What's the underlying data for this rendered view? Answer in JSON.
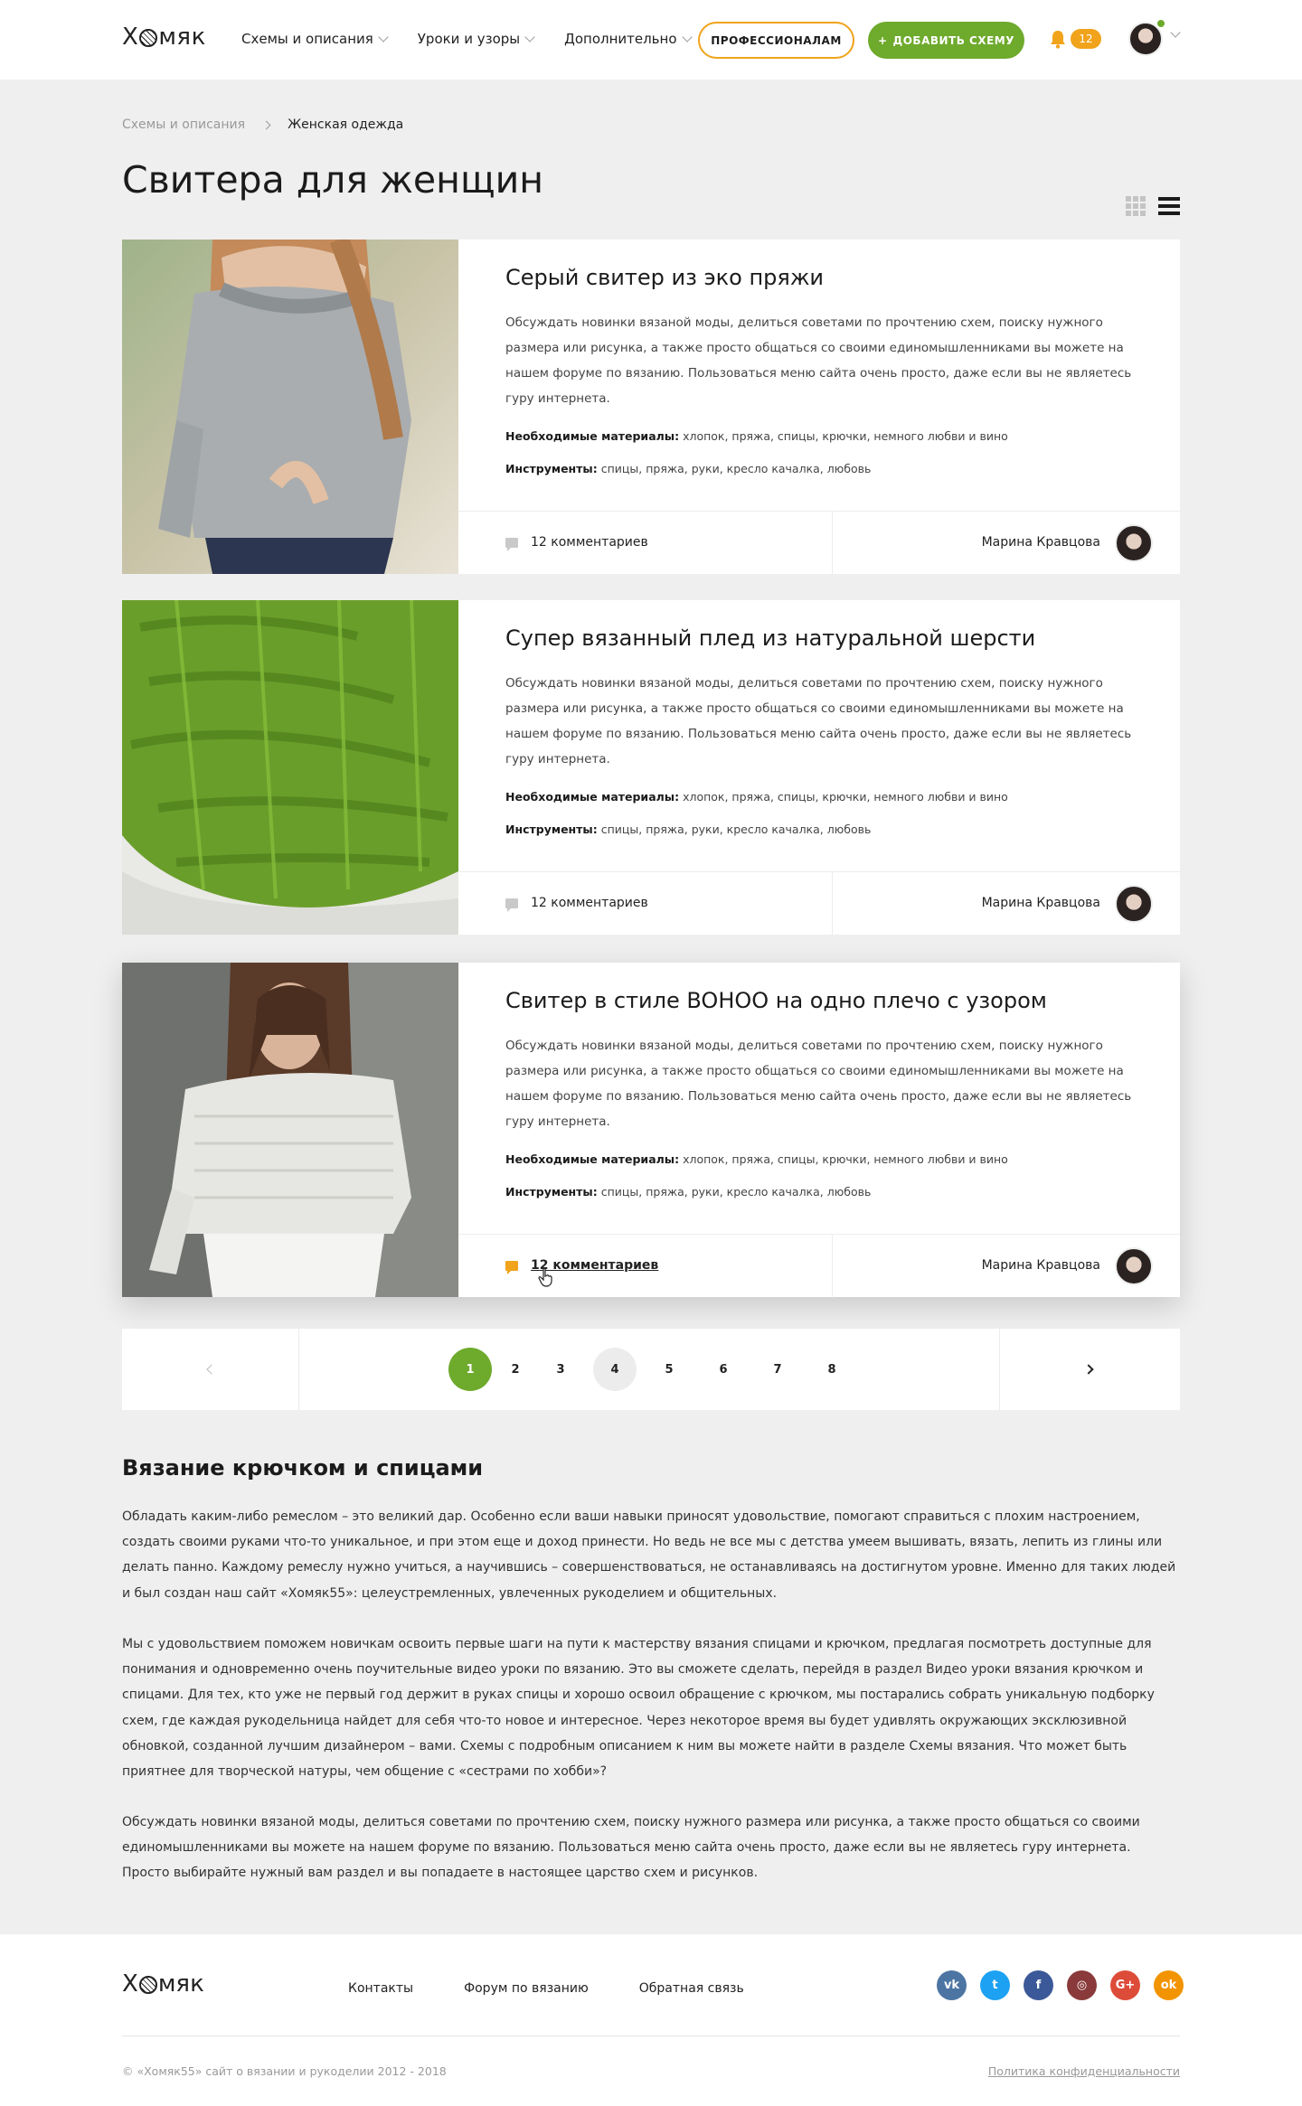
{
  "header": {
    "logo": "Хомяк",
    "nav": [
      {
        "label": "Схемы и описания"
      },
      {
        "label": "Уроки и узоры"
      },
      {
        "label": "Дополнительно"
      }
    ],
    "btn_pro": "ПРОФЕССИОНАЛАМ",
    "btn_add": "ДОБАВИТЬ СХЕМУ",
    "notifications": "12",
    "accent": "#6eaa2c",
    "orange": "#f0a31b"
  },
  "breadcrumb": {
    "parent": "Схемы и описания",
    "current": "Женская одежда"
  },
  "page_title": "Свитера для женщин",
  "cards": [
    {
      "title": "Серый свитер из эко пряжи",
      "desc": "Обсуждать новинки вязаной моды, делиться советами по прочтению схем, поиску нужного размера или рисунка, а также просто общаться со своими единомышленниками вы можете на нашем форуме по вязанию. Пользоваться меню сайта очень просто, даже если вы не являетесь гуру интернета.",
      "materials_label": "Необходимые материалы:",
      "materials": "хлопок, пряжа, спицы, крючки, немного любви и вино",
      "tools_label": "Инструменты:",
      "tools": "спицы, пряжа, руки, кресло качалка, любовь",
      "comments": "12 комментариев",
      "author": "Марина Кравцова"
    },
    {
      "title": "Супер вязанный плед из натуральной шерсти",
      "desc": "Обсуждать новинки вязаной моды, делиться советами по прочтению схем, поиску нужного размера или рисунка, а также просто общаться со своими единомышленниками вы можете на нашем форуме по вязанию. Пользоваться меню сайта очень просто, даже если вы не являетесь гуру интернета.",
      "materials_label": "Необходимые материалы:",
      "materials": "хлопок, пряжа, спицы, крючки, немного любви и вино",
      "tools_label": "Инструменты:",
      "tools": "спицы, пряжа, руки, кресло качалка, любовь",
      "comments": "12 комментариев",
      "author": "Марина Кравцова"
    },
    {
      "title": "Свитер в стиле BOHOO на одно плечо с узором",
      "desc": "Обсуждать новинки вязаной моды, делиться советами по прочтению схем, поиску нужного размера или рисунка, а также просто общаться со своими единомышленниками вы можете на нашем форуме по вязанию. Пользоваться меню сайта очень просто, даже если вы не являетесь гуру интернета.",
      "materials_label": "Необходимые материалы:",
      "materials": "хлопок, пряжа, спицы, крючки, немного любви и вино",
      "tools_label": "Инструменты:",
      "tools": "спицы, пряжа, руки, кресло качалка, любовь",
      "comments": "12 комментариев",
      "author": "Марина Кравцова"
    }
  ],
  "pagination": {
    "pages": [
      "1",
      "2",
      "3",
      "4",
      "5",
      "6",
      "7",
      "8"
    ],
    "current": "1"
  },
  "article": {
    "title": "Вязание крючком и спицами",
    "p1": "Обладать каким-либо ремеслом – это великий дар. Особенно если ваши навыки приносят удовольствие, помогают справиться с плохим настроением, создать своими руками что-то уникальное, и при этом еще и доход принести. Но ведь не все мы с детства умеем вышивать, вязать, лепить из глины или делать панно. Каждому ремеслу нужно учиться, а научившись – совершенствоваться, не останавливаясь на достигнутом уровне. Именно для таких людей и был создан наш сайт «Хомяк55»: целеустремленных, увлеченных рукоделием и общительных.",
    "p2": "Мы с удовольствием поможем новичкам освоить первые шаги на пути к мастерству вязания спицами и крючком, предлагая посмотреть доступные для понимания и одновременно очень поучительные видео уроки по вязанию. Это вы сможете сделать, перейдя в раздел Видео уроки вязания крючком и спицами. Для тех, кто уже не первый год держит в руках спицы и хорошо освоил обращение с крючком, мы постарались собрать уникальную подборку схем, где каждая рукодельница найдет для себя что-то новое и интересное. Через некоторое время вы будет удивлять окружающих эксклюзивной обновкой, созданной лучшим дизайнером – вами. Схемы с подробным описанием к ним вы можете найти в разделе Схемы вязания. Что может быть приятнее для творческой натуры, чем общение с «сестрами по хобби»?",
    "p3": "Обсуждать новинки вязаной моды, делиться советами по прочтению схем, поиску нужного размера или рисунка, а также просто общаться со своими единомышленниками вы можете на нашем форуме по вязанию. Пользоваться меню сайта очень просто, даже если вы не являетесь гуру интернета. Просто выбирайте нужный вам раздел и вы попадаете в настоящее царство схем и рисунков."
  },
  "footer": {
    "logo": "Хомяк",
    "links": [
      "Контакты",
      "Форум по вязанию",
      "Обратная связь"
    ],
    "socials": [
      {
        "icon": "vk-icon",
        "glyph": "vk",
        "color": "#4c75a3"
      },
      {
        "icon": "twitter-icon",
        "glyph": "t",
        "color": "#1da1f2"
      },
      {
        "icon": "facebook-icon",
        "glyph": "f",
        "color": "#3b5998"
      },
      {
        "icon": "instagram-icon",
        "glyph": "◎",
        "color": "#8a3a3a"
      },
      {
        "icon": "googleplus-icon",
        "glyph": "G+",
        "color": "#dd4b39"
      },
      {
        "icon": "odnoklassniki-icon",
        "glyph": "ok",
        "color": "#f29400"
      }
    ],
    "copyright": "© «Хомяк55» сайт о вязании и рукоделии 2012 - 2018",
    "privacy": "Политика конфиденциальности"
  }
}
